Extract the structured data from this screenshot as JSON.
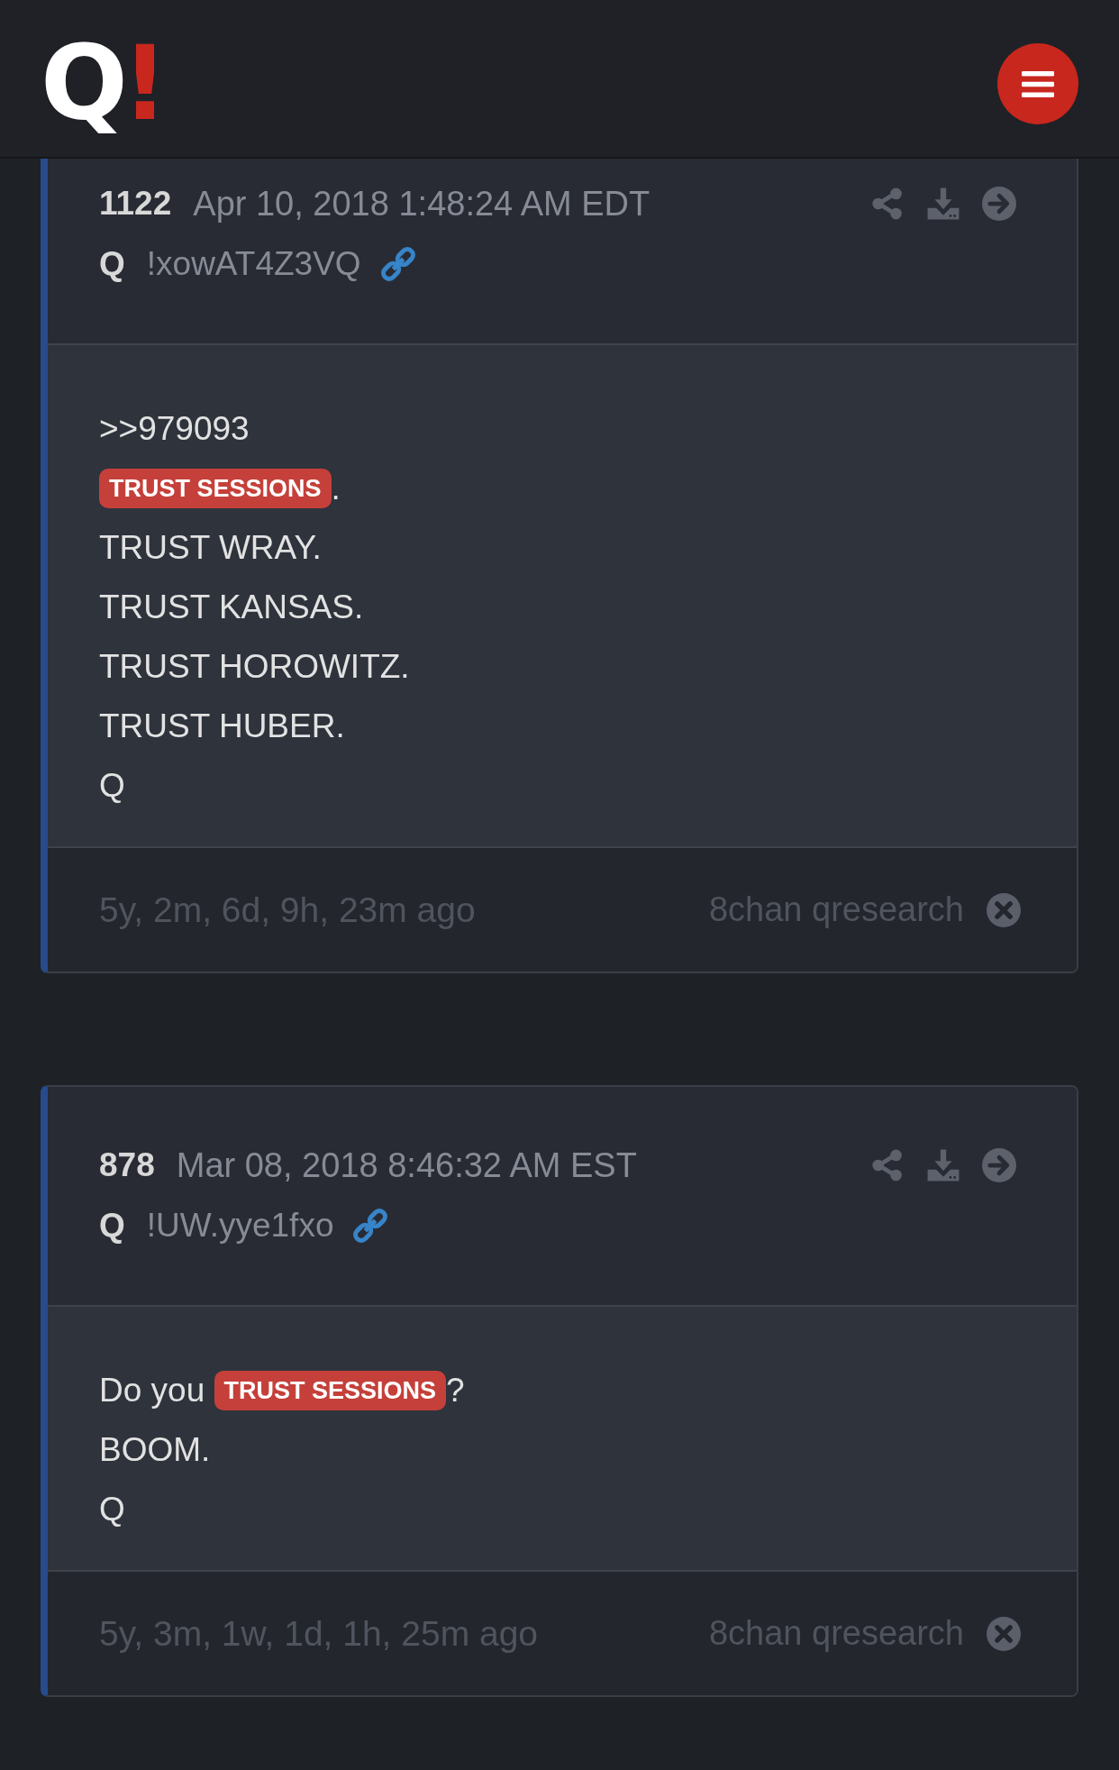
{
  "header": {
    "logo": {
      "letter": "Q",
      "mark": "!"
    }
  },
  "posts": [
    {
      "number": "1122",
      "date": "Apr 10, 2018 1:48:24 AM EDT",
      "author": "Q",
      "tripcode": "!xowAT4Z3VQ",
      "lines": [
        [
          {
            "kind": "plain",
            "text": ">>979093"
          }
        ],
        [
          {
            "kind": "highlight",
            "text": "TRUST SESSIONS"
          },
          {
            "kind": "plain",
            "text": "."
          }
        ],
        [
          {
            "kind": "plain",
            "text": "TRUST WRAY."
          }
        ],
        [
          {
            "kind": "plain",
            "text": "TRUST KANSAS."
          }
        ],
        [
          {
            "kind": "plain",
            "text": "TRUST HOROWITZ."
          }
        ],
        [
          {
            "kind": "plain",
            "text": "TRUST HUBER."
          }
        ],
        [
          {
            "kind": "plain",
            "text": "Q"
          }
        ]
      ],
      "age": "5y, 2m, 6d, 9h, 23m ago",
      "source": "8chan qresearch"
    },
    {
      "number": "878",
      "date": "Mar 08, 2018 8:46:32 AM EST",
      "author": "Q",
      "tripcode": "!UW.yye1fxo",
      "lines": [
        [
          {
            "kind": "plain",
            "text": "Do you "
          },
          {
            "kind": "highlight",
            "text": "TRUST SESSIONS"
          },
          {
            "kind": "plain",
            "text": "?"
          }
        ],
        [
          {
            "kind": "plain",
            "text": "BOOM."
          }
        ],
        [
          {
            "kind": "plain",
            "text": "Q"
          }
        ]
      ],
      "age": "5y, 3m, 1w, 1d, 1h, 25m ago",
      "source": "8chan qresearch"
    }
  ]
}
